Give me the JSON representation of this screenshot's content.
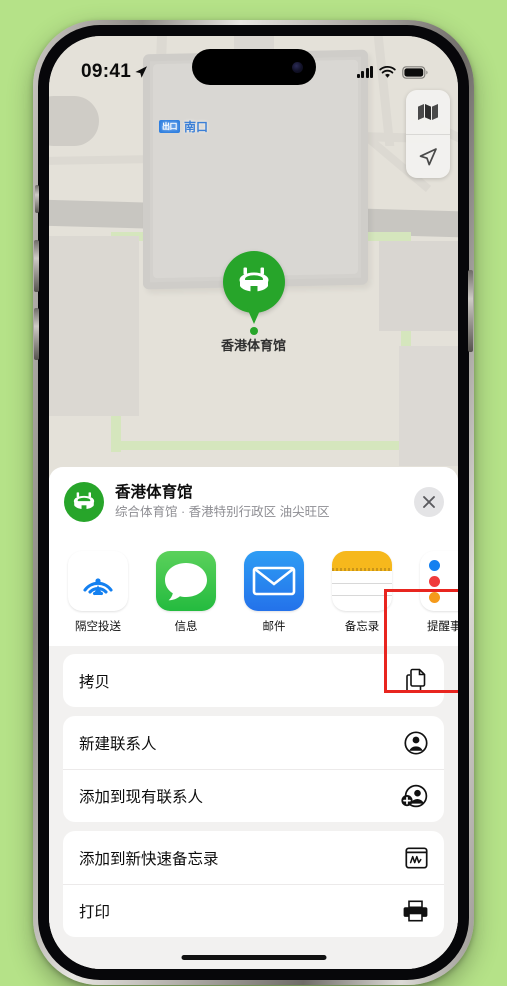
{
  "status_bar": {
    "time": "09:41",
    "location_arrow": "location-arrow-icon",
    "cellular": "cellular-bars-icon",
    "wifi": "wifi-icon",
    "battery": "battery-icon"
  },
  "map": {
    "exit_chip": "出口",
    "exit_label": "南口",
    "pin_label": "香港体育馆",
    "controls": [
      {
        "name": "map-type-button",
        "icon": "folded-map-icon"
      },
      {
        "name": "locate-me-button",
        "icon": "navigation-arrow-icon"
      }
    ]
  },
  "share_sheet": {
    "place_title": "香港体育馆",
    "place_subtitle": "综合体育馆 · 香港特别行政区 油尖旺区",
    "close_label": "×",
    "apps": [
      {
        "label": "隔空投送",
        "icon": "airdrop-icon",
        "highlighted": false
      },
      {
        "label": "信息",
        "icon": "messages-icon",
        "highlighted": false
      },
      {
        "label": "邮件",
        "icon": "mail-icon",
        "highlighted": false
      },
      {
        "label": "备忘录",
        "icon": "notes-icon",
        "highlighted": true
      },
      {
        "label": "提醒事项",
        "icon": "reminders-icon",
        "highlighted": false
      }
    ],
    "action_groups": [
      {
        "rows": [
          {
            "label": "拷贝",
            "icon": "copy-doc-icon"
          }
        ]
      },
      {
        "rows": [
          {
            "label": "新建联系人",
            "icon": "person-circle-icon"
          },
          {
            "label": "添加到现有联系人",
            "icon": "person-badge-plus-icon"
          }
        ]
      },
      {
        "rows": [
          {
            "label": "添加到新快速备忘录",
            "icon": "quick-note-icon"
          },
          {
            "label": "打印",
            "icon": "printer-icon"
          }
        ]
      }
    ]
  },
  "colors": {
    "background": "#b5e288",
    "accent_green": "#27a52a",
    "highlight_red": "#e8251f",
    "map_base": "#e4e1d9"
  }
}
